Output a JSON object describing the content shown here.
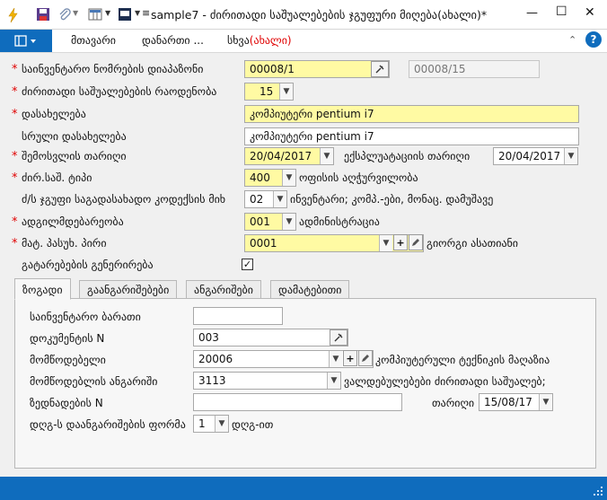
{
  "titlebar": {
    "title": "sample7 - ძირითადი საშუალებების ჯგუფური მიღება(ახალი)*",
    "minimize": "—",
    "maximize": "☐",
    "close": "✕"
  },
  "menubar": {
    "items": [
      "მთავარი",
      "დანართი ...",
      "სხვა"
    ],
    "extra": "(ახალი)",
    "help": "?"
  },
  "form": {
    "inventory_range": {
      "label": "საინვენტარო ნომრების დიაპაზონი",
      "from": "00008/1",
      "to": "00008/15"
    },
    "quantity": {
      "label": "ძირითადი საშუალებების რაოდენობა",
      "value": "15"
    },
    "name": {
      "label": "დასახელება",
      "value": "კომპიუტერი pentium i7"
    },
    "full_name": {
      "label": "სრული დასახელება",
      "value": "კომპიუტერი pentium i7"
    },
    "receipt_date": {
      "label": "შემოსვლის თარიღი",
      "value": "20/04/2017"
    },
    "exploitation_date": {
      "label": "ექსპლუატაციის თარიღი",
      "value": "20/04/2017"
    },
    "type": {
      "label": "ძირ.საშ. ტიპი",
      "value": "400",
      "desc": "ოფისის აღჭურვილობა"
    },
    "group": {
      "label": "ძ/ს ჯგუფი საგადასახადო კოდექსის მიხ",
      "value": "02",
      "desc": "ინვენტარი; კომპ.-ები, მონაც. დამუშავე"
    },
    "location": {
      "label": "ადგილმდებარეობა",
      "value": "001",
      "desc": "ადმინისტრაცია"
    },
    "responsible": {
      "label": "მატ. პასუხ. პირი",
      "value": "0001",
      "desc": "გიორგი ასათიანი"
    },
    "generate_transactions": {
      "label": "გატარებების გენერირება",
      "checked": true
    }
  },
  "tabs": [
    "ზოგადი",
    "გაანგარიშებები",
    "ანგარიშები",
    "დამატებითი"
  ],
  "general": {
    "inventory_card": {
      "label": "საინვენტარო ბარათი",
      "value": ""
    },
    "doc_number": {
      "label": "დოკუმენტის N",
      "value": "003"
    },
    "supplier": {
      "label": "მომწოდებელი",
      "value": "20006",
      "desc": "კომპიუტერული ტექნიკის მაღაზია"
    },
    "supplier_account": {
      "label": "მომწოდებლის ანგარიში",
      "value": "3113",
      "desc": "ვალდებულებები ძირითადი საშუალებ;"
    },
    "invoice_number": {
      "label": "ზედნადების N",
      "value": ""
    },
    "date": {
      "label": "თარიღი",
      "value": "15/08/17"
    },
    "vat_form": {
      "label": "დღგ-ს დაანგარიშების ფორმა",
      "value": "1",
      "desc": "დღგ-ით"
    }
  },
  "colors": {
    "accent": "#0f6cbd",
    "required": "#e00000",
    "highlight": "#fffaa3"
  }
}
